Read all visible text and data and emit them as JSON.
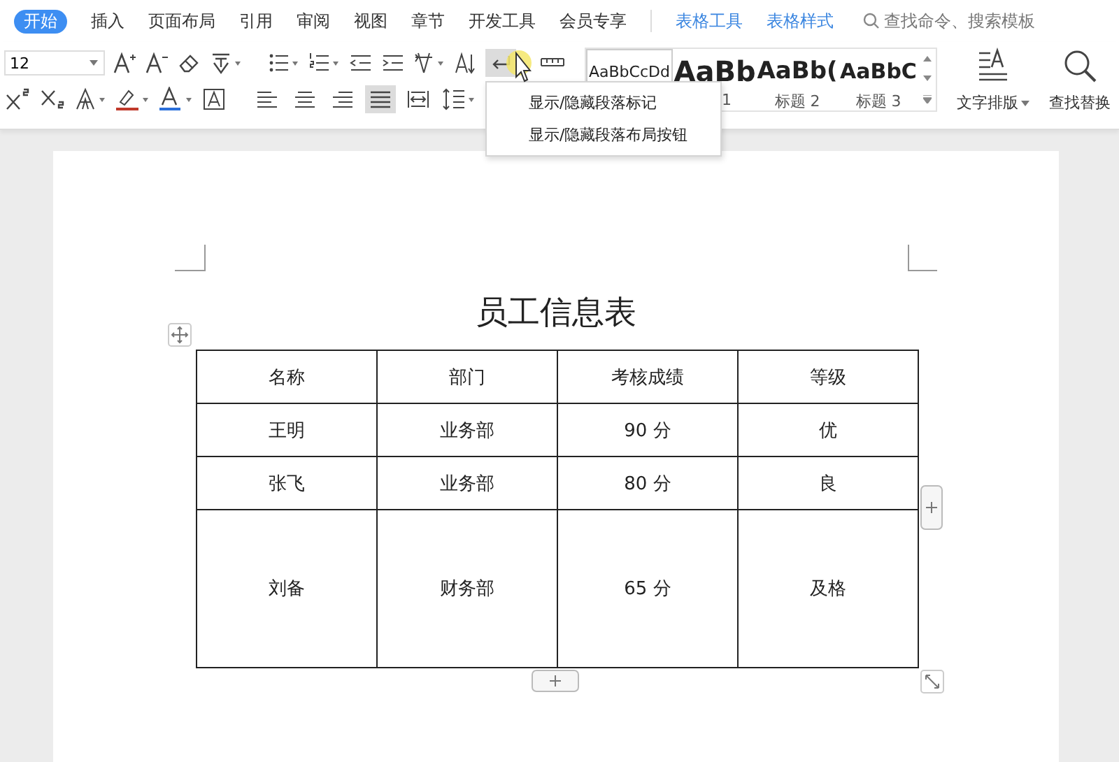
{
  "menu_tabs": [
    {
      "label": "开始",
      "selected": true,
      "kind": "main"
    },
    {
      "label": "插入",
      "selected": false,
      "kind": "main"
    },
    {
      "label": "页面布局",
      "selected": false,
      "kind": "main"
    },
    {
      "label": "引用",
      "selected": false,
      "kind": "main"
    },
    {
      "label": "审阅",
      "selected": false,
      "kind": "main"
    },
    {
      "label": "视图",
      "selected": false,
      "kind": "main"
    },
    {
      "label": "章节",
      "selected": false,
      "kind": "main"
    },
    {
      "label": "开发工具",
      "selected": false,
      "kind": "main"
    },
    {
      "label": "会员专享",
      "selected": false,
      "kind": "main"
    },
    {
      "label": "表格工具",
      "selected": false,
      "kind": "context"
    },
    {
      "label": "表格样式",
      "selected": false,
      "kind": "context"
    }
  ],
  "search": {
    "placeholder": "查找命令、搜索模板"
  },
  "font_size": {
    "value": "12"
  },
  "paragraph_row1": [
    {
      "kind": "show-hide",
      "selected": true
    },
    {
      "kind": "table-layout",
      "selected": false
    }
  ],
  "paragraph_row2": [
    {
      "kind": "align-left",
      "selected": false
    },
    {
      "kind": "align-center",
      "selected": false
    },
    {
      "kind": "align-right",
      "selected": false
    },
    {
      "kind": "justify",
      "selected": true
    },
    {
      "kind": "distributed",
      "selected": false
    }
  ],
  "styles": [
    {
      "sample": "AaBbCcDd",
      "kind": "normal"
    },
    {
      "sample": "AaBb",
      "label": "1",
      "kind": "heading1"
    },
    {
      "sample": "AaBb(",
      "label": "标题 2",
      "kind": "heading2"
    },
    {
      "sample": "AaBbC",
      "label": "标题 3",
      "kind": "heading3"
    }
  ],
  "tools": [
    {
      "label": "文字排版",
      "kind": "text-layout"
    },
    {
      "label": "查找替换",
      "kind": "find-replace"
    }
  ],
  "dropdown_menu": {
    "items": [
      "显示/隐藏段落标记",
      "显示/隐藏段落布局按钮"
    ]
  },
  "document": {
    "title": "员工信息表",
    "table": {
      "columns": [
        "名称",
        "部门",
        "考核成绩",
        "等级"
      ],
      "rows": [
        [
          "王明",
          "业务部",
          "90 分",
          "优"
        ],
        [
          "张飞",
          "业务部",
          "80 分",
          "良"
        ],
        [
          "刘备",
          "财务部",
          "65 分",
          "及格"
        ]
      ]
    }
  }
}
